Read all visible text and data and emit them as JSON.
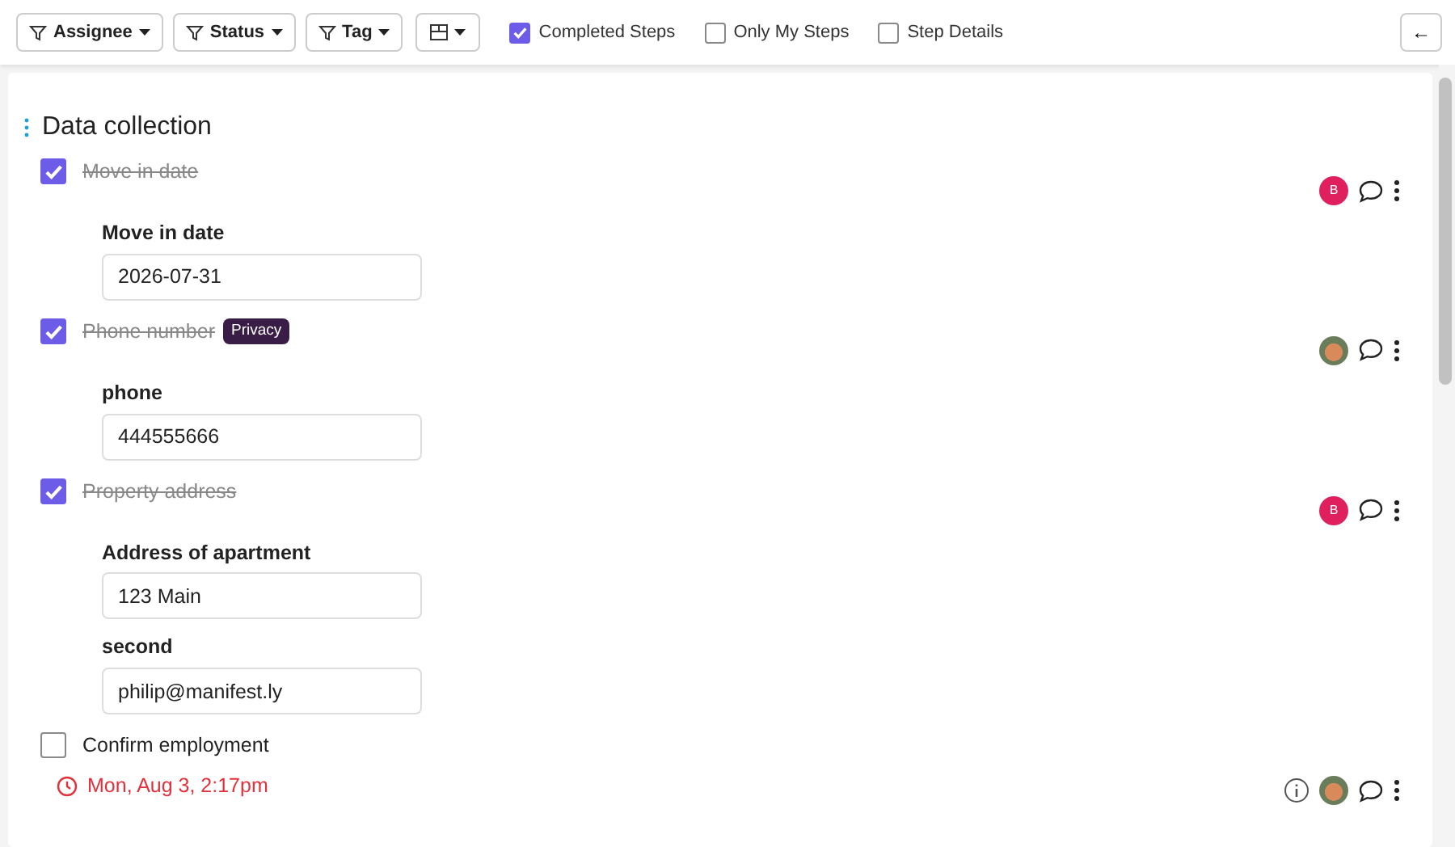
{
  "toolbar": {
    "filters": [
      {
        "label": "Assignee",
        "kind": "filter"
      },
      {
        "label": "Status",
        "kind": "filter"
      },
      {
        "label": "Tag",
        "kind": "filter"
      },
      {
        "kind": "layout"
      }
    ],
    "toggles": [
      {
        "label": "Completed Steps",
        "checked": true
      },
      {
        "label": "Only My Steps",
        "checked": false
      },
      {
        "label": "Step Details",
        "checked": false
      }
    ],
    "back_button": "←"
  },
  "section": {
    "title": "Data collection"
  },
  "steps": [
    {
      "title": "Move in date",
      "checked": true,
      "avatar": {
        "kind": "initial",
        "text": "B"
      },
      "info": false,
      "fields": [
        {
          "label": "Move in date",
          "value": "2026-07-31"
        }
      ]
    },
    {
      "title": "Phone number",
      "checked": true,
      "badge": "Privacy",
      "avatar": {
        "kind": "photo"
      },
      "info": false,
      "fields": [
        {
          "label": "phone",
          "value": "444555666"
        }
      ]
    },
    {
      "title": "Property address",
      "checked": true,
      "avatar": {
        "kind": "initial",
        "text": "B"
      },
      "info": false,
      "fields": [
        {
          "label": "Address of apartment",
          "value": "123 Main"
        },
        {
          "label": "second",
          "value": "philip@manifest.ly"
        }
      ]
    },
    {
      "title": "Confirm employment",
      "checked": false,
      "due": "Mon, Aug 3, 2:17pm",
      "avatar": {
        "kind": "photo"
      },
      "info": true
    }
  ]
}
